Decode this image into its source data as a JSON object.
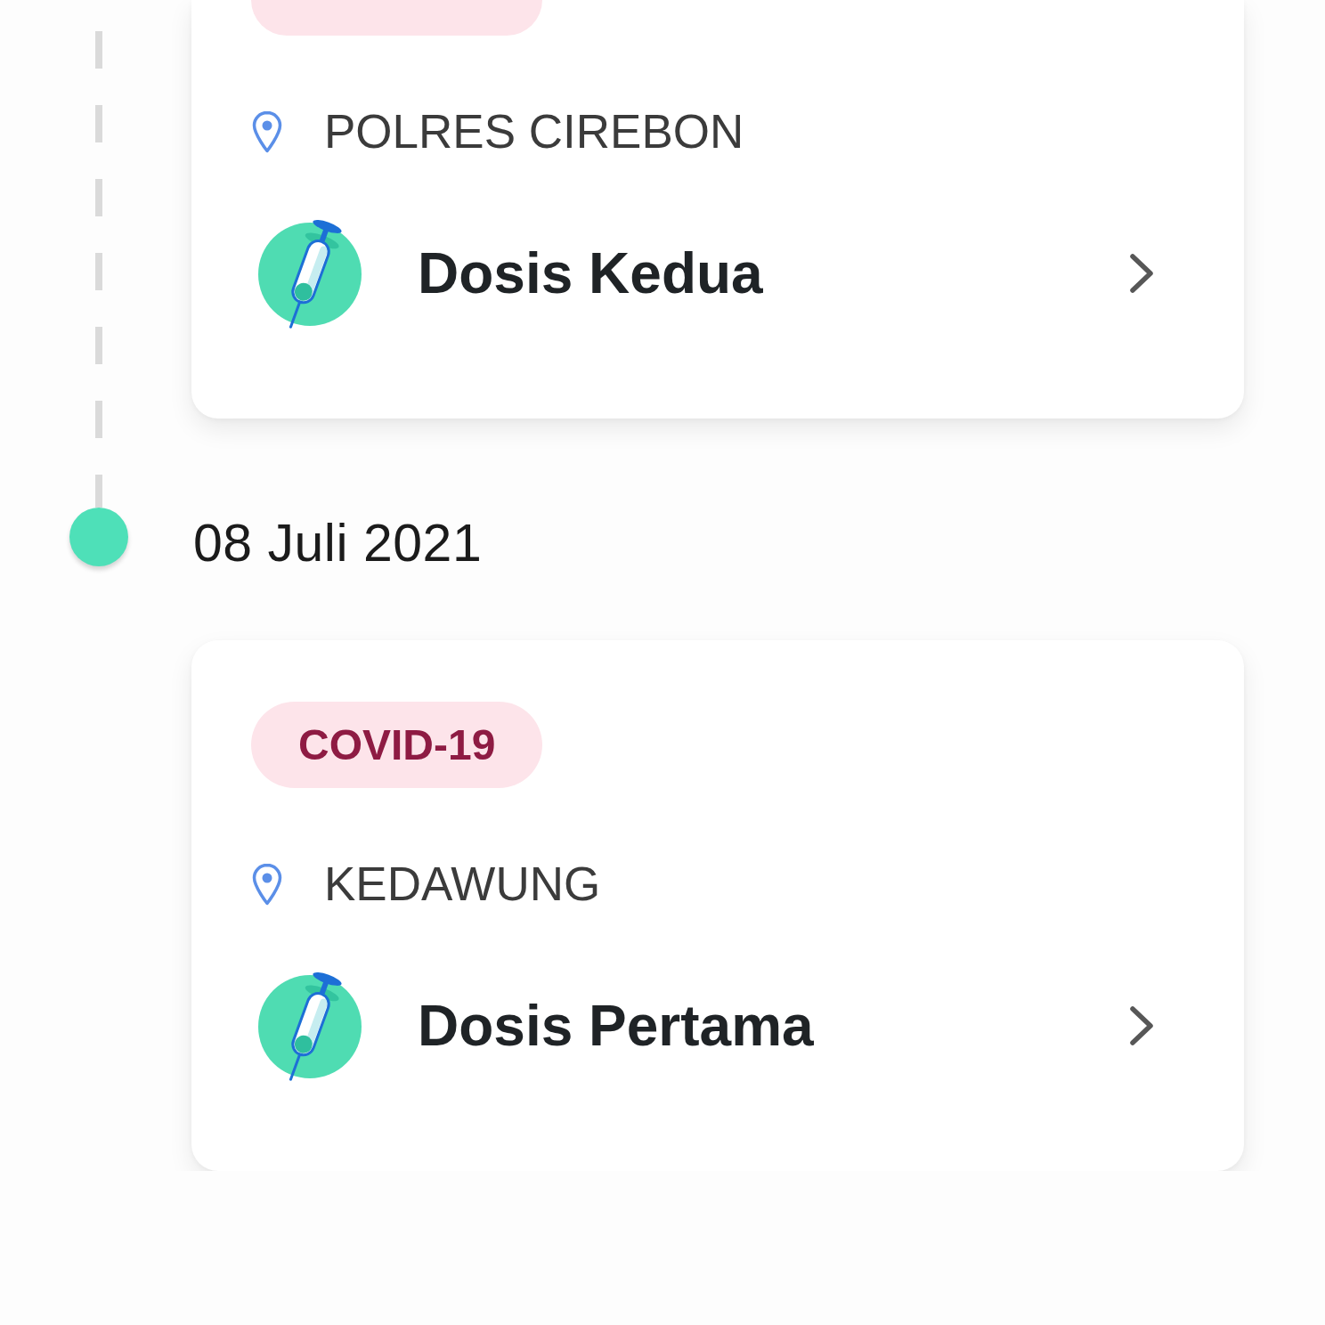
{
  "timeline": [
    {
      "kind": "clipped-card",
      "location": "POLRES CIREBON",
      "dose": "Dosis Kedua"
    },
    {
      "kind": "date",
      "date": "08 Juli 2021"
    },
    {
      "kind": "card",
      "tag": "COVID-19",
      "location": "KEDAWUNG",
      "dose": "Dosis Pertama"
    }
  ]
}
